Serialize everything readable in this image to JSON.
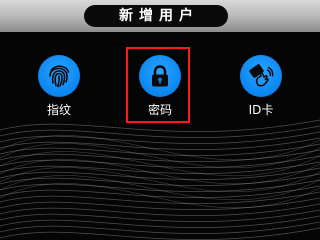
{
  "header": {
    "title": "新增用户"
  },
  "options": [
    {
      "label": "指纹",
      "icon": "fingerprint-icon"
    },
    {
      "label": "密码",
      "icon": "lock-icon",
      "selected": true
    },
    {
      "label": "ID卡",
      "icon": "id-card-tap-icon"
    }
  ],
  "colors": {
    "icon_circle": "#0a86f2",
    "selection_frame": "#ff1a1a",
    "header_bar": "#bdbdbd",
    "title_pill": "#0a0a0a",
    "background": "#050505"
  }
}
